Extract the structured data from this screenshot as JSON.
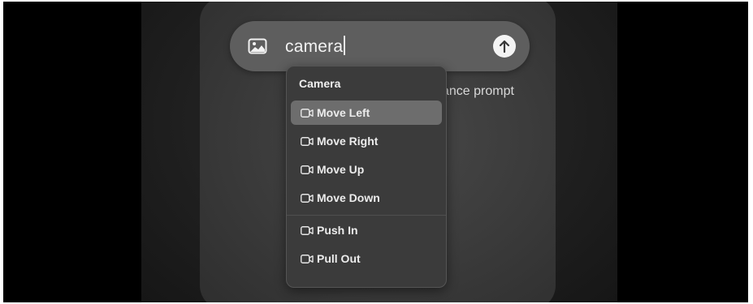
{
  "search": {
    "value": "camera",
    "image_icon": "image-icon",
    "send_icon": "arrow-up-icon"
  },
  "background_hint": "ance prompt",
  "dropdown": {
    "header": "Camera",
    "items": [
      {
        "label": "Move Left",
        "icon": "video-camera-icon",
        "selected": true
      },
      {
        "label": "Move Right",
        "icon": "video-camera-icon",
        "selected": false
      },
      {
        "label": "Move Up",
        "icon": "video-camera-icon",
        "selected": false
      },
      {
        "label": "Move Down",
        "icon": "video-camera-icon",
        "selected": false
      },
      {
        "label": "Push In",
        "icon": "video-camera-icon",
        "selected": false
      },
      {
        "label": "Pull Out",
        "icon": "video-camera-icon",
        "selected": false
      }
    ]
  },
  "colors": {
    "search_bar": "#5e5e5e",
    "dropdown": "#3b3b3b",
    "selected_item": "#6d6d6d",
    "text": "#f0f0f0"
  }
}
